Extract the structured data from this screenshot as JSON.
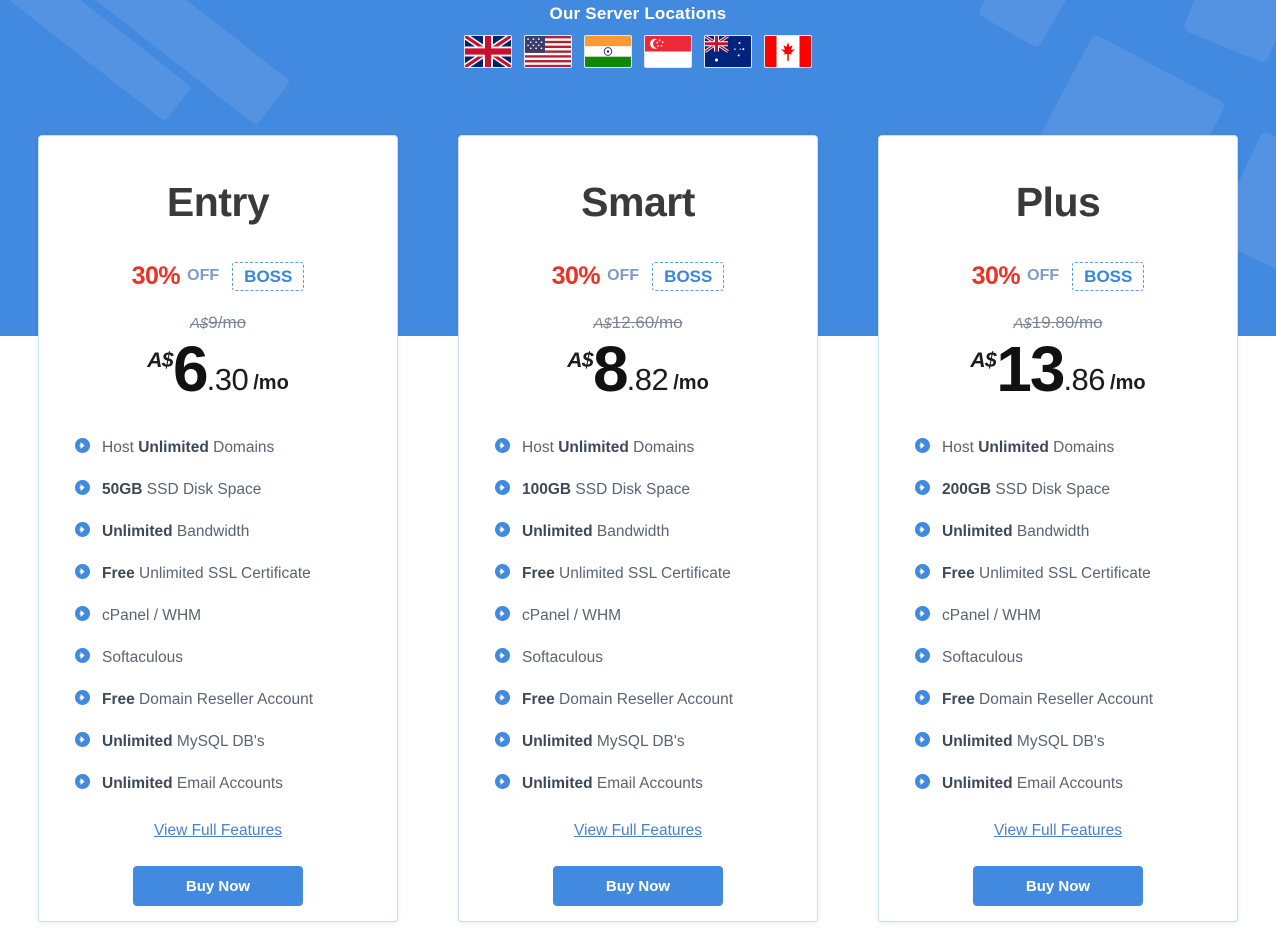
{
  "hero": {
    "title": "Our Server Locations",
    "flags": [
      {
        "name": "flag-uk",
        "label": "United Kingdom"
      },
      {
        "name": "flag-usa",
        "label": "United States"
      },
      {
        "name": "flag-india",
        "label": "India"
      },
      {
        "name": "flag-singapore",
        "label": "Singapore"
      },
      {
        "name": "flag-australia",
        "label": "Australia"
      },
      {
        "name": "flag-canada",
        "label": "Canada"
      }
    ],
    "background_color": "#4289e0"
  },
  "colors": {
    "accent_blue": "#4289e0",
    "discount_red": "#ee3124",
    "coupon_blue": "#3b85e0",
    "off_text": "#7f9ac5",
    "feature_text": "#5a6472",
    "title_text": "#3a3a3a"
  },
  "common": {
    "discount_percent": "30%",
    "off_label": "OFF",
    "coupon_code": "BOSS",
    "currency": "A$",
    "per_month": "/mo",
    "view_full_features": "View Full Features",
    "buy_now": "Buy Now"
  },
  "plans": [
    {
      "name": "Entry",
      "discount_percent": "30%",
      "off_label": "OFF",
      "coupon_code": "BOSS",
      "old_price_currency": "A$",
      "old_price_amount": "9",
      "old_price_suffix": "/mo",
      "currency": "A$",
      "price_whole": "6",
      "price_cents": ".30",
      "price_suffix": "/mo",
      "features": [
        {
          "pre": "Host ",
          "bold": "Unlimited",
          "post": " Domains"
        },
        {
          "pre": "",
          "bold": "50GB",
          "post": " SSD Disk Space"
        },
        {
          "pre": "",
          "bold": "Unlimited",
          "post": " Bandwidth"
        },
        {
          "pre": "",
          "bold": "Free",
          "post": " Unlimited SSL Certificate"
        },
        {
          "pre": "cPanel / WHM",
          "bold": "",
          "post": ""
        },
        {
          "pre": "Softaculous",
          "bold": "",
          "post": ""
        },
        {
          "pre": "",
          "bold": "Free",
          "post": " Domain Reseller Account"
        },
        {
          "pre": "",
          "bold": "Unlimited",
          "post": " MySQL DB's"
        },
        {
          "pre": "",
          "bold": "Unlimited",
          "post": " Email Accounts"
        }
      ],
      "view_full_features": "View Full Features",
      "buy_now": "Buy Now"
    },
    {
      "name": "Smart",
      "discount_percent": "30%",
      "off_label": "OFF",
      "coupon_code": "BOSS",
      "old_price_currency": "A$",
      "old_price_amount": "12.60",
      "old_price_suffix": "/mo",
      "currency": "A$",
      "price_whole": "8",
      "price_cents": ".82",
      "price_suffix": "/mo",
      "features": [
        {
          "pre": "Host ",
          "bold": "Unlimited",
          "post": " Domains"
        },
        {
          "pre": "",
          "bold": "100GB",
          "post": " SSD Disk Space"
        },
        {
          "pre": "",
          "bold": "Unlimited",
          "post": " Bandwidth"
        },
        {
          "pre": "",
          "bold": "Free",
          "post": " Unlimited SSL Certificate"
        },
        {
          "pre": "cPanel / WHM",
          "bold": "",
          "post": ""
        },
        {
          "pre": "Softaculous",
          "bold": "",
          "post": ""
        },
        {
          "pre": "",
          "bold": "Free",
          "post": " Domain Reseller Account"
        },
        {
          "pre": "",
          "bold": "Unlimited",
          "post": " MySQL DB's"
        },
        {
          "pre": "",
          "bold": "Unlimited",
          "post": " Email Accounts"
        }
      ],
      "view_full_features": "View Full Features",
      "buy_now": "Buy Now"
    },
    {
      "name": "Plus",
      "discount_percent": "30%",
      "off_label": "OFF",
      "coupon_code": "BOSS",
      "old_price_currency": "A$",
      "old_price_amount": "19.80",
      "old_price_suffix": "/mo",
      "currency": "A$",
      "price_whole": "13",
      "price_cents": ".86",
      "price_suffix": "/mo",
      "features": [
        {
          "pre": "Host ",
          "bold": "Unlimited",
          "post": " Domains"
        },
        {
          "pre": "",
          "bold": "200GB",
          "post": " SSD Disk Space"
        },
        {
          "pre": "",
          "bold": "Unlimited",
          "post": " Bandwidth"
        },
        {
          "pre": "",
          "bold": "Free",
          "post": " Unlimited SSL Certificate"
        },
        {
          "pre": "cPanel / WHM",
          "bold": "",
          "post": ""
        },
        {
          "pre": "Softaculous",
          "bold": "",
          "post": ""
        },
        {
          "pre": "",
          "bold": "Free",
          "post": " Domain Reseller Account"
        },
        {
          "pre": "",
          "bold": "Unlimited",
          "post": " MySQL DB's"
        },
        {
          "pre": "",
          "bold": "Unlimited",
          "post": " Email Accounts"
        }
      ],
      "view_full_features": "View Full Features",
      "buy_now": "Buy Now"
    }
  ]
}
